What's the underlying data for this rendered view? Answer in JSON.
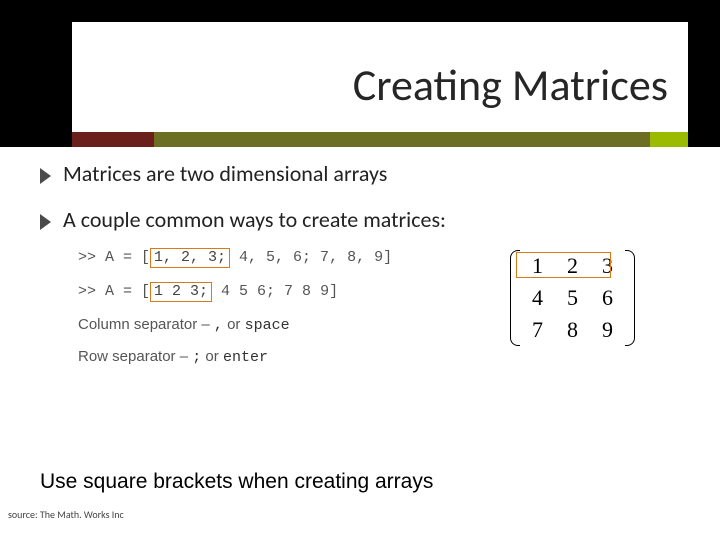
{
  "title": "Creating Matrices",
  "bullets": {
    "b1": "Matrices are two dimensional arrays",
    "b2": "A couple common ways to create matrices:"
  },
  "code": {
    "prompt": ">> ",
    "lhs": "A = [",
    "row1_hl": "1, 2, 3;",
    "row1_rest": " 4, 5, 6; 7, 8, 9]",
    "row2_hl": "1 2 3;",
    "row2_rest": " 4 5 6; 7 8 9]"
  },
  "sep": {
    "col_label": "Column separator – ",
    "col_tok1": ",",
    "col_or": " or ",
    "col_tok2": "space",
    "row_label": "Row separator – ",
    "row_tok1": ";",
    "row_or": " or ",
    "row_tok2": "enter"
  },
  "matrix": {
    "r1c1": "1",
    "r1c2": "2",
    "r1c3": "3",
    "r2c1": "4",
    "r2c2": "5",
    "r2c3": "6",
    "r3c1": "7",
    "r3c2": "8",
    "r3c3": "9"
  },
  "footer": "Use square brackets when creating arrays",
  "source": "source: The Math. Works Inc"
}
